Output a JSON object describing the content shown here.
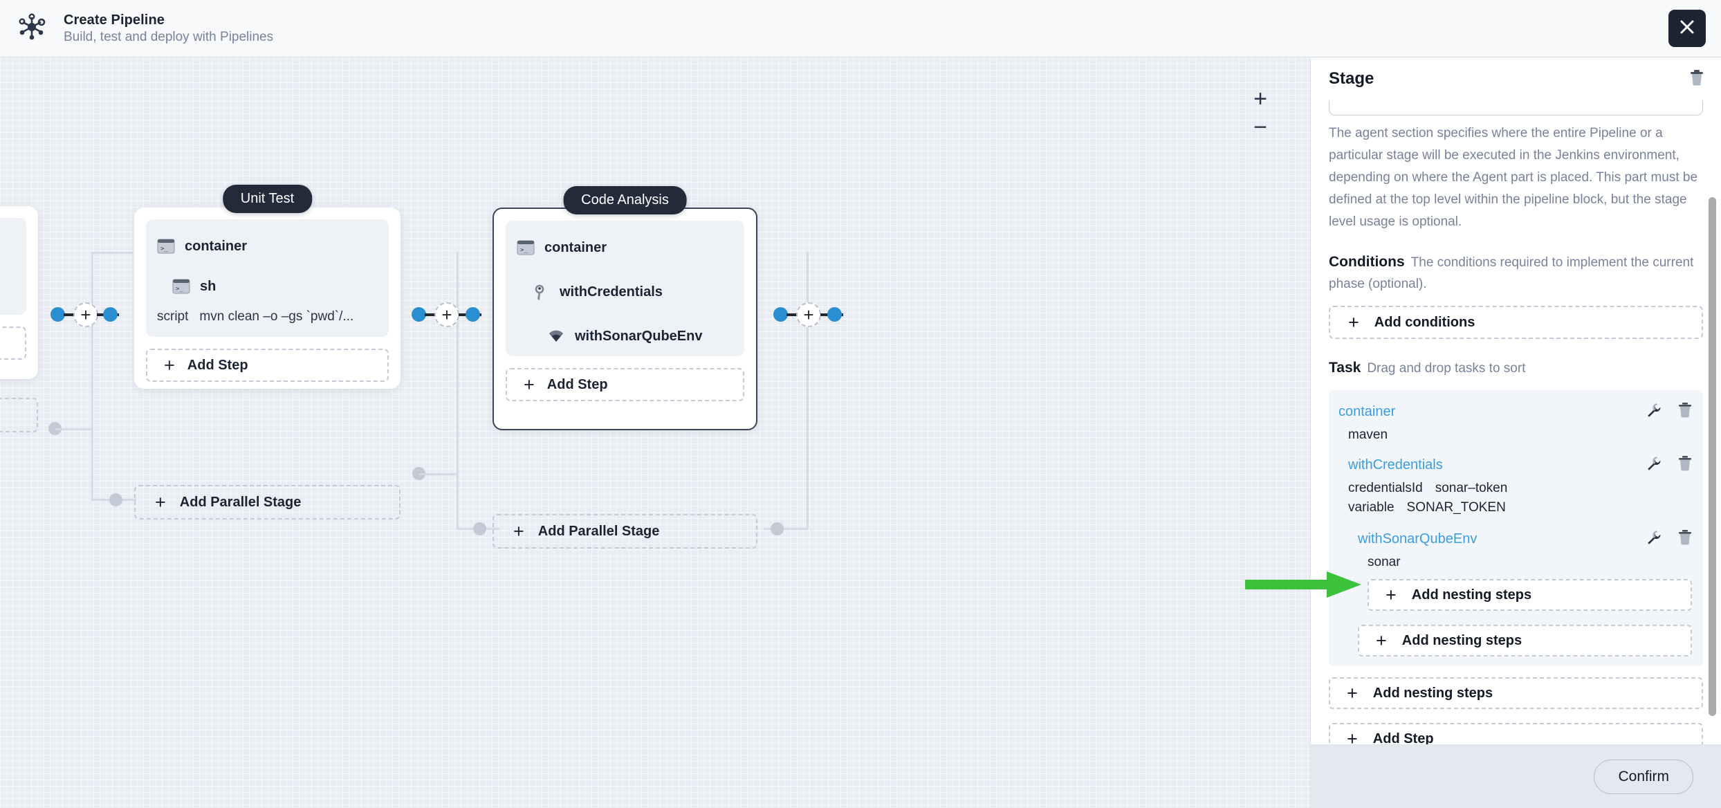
{
  "header": {
    "logo_icon": "pipeline-network-icon",
    "title": "Create Pipeline",
    "subtitle": "Build, test and deploy with Pipelines",
    "close_icon": "close-icon"
  },
  "canvas": {
    "zoom_in_label": "+",
    "zoom_out_label": "−",
    "add_node_label": "+",
    "stages": [
      {
        "name": "Unit Test",
        "steps": [
          {
            "icon": "terminal-icon",
            "label": "container",
            "indent": 0
          },
          {
            "icon": "terminal-icon",
            "label": "sh",
            "indent": 1
          }
        ],
        "params": [
          {
            "key": "script",
            "value": "mvn clean –o –gs `pwd`/..."
          }
        ],
        "add_step_label": "Add Step",
        "add_parallel_label": "Add Parallel Stage"
      },
      {
        "name": "Code Analysis",
        "selected": true,
        "steps": [
          {
            "icon": "terminal-icon",
            "label": "container",
            "indent": 0
          },
          {
            "icon": "key-icon",
            "label": "withCredentials",
            "indent": 1
          },
          {
            "icon": "sonar-icon",
            "label": "withSonarQubeEnv",
            "indent": 2
          }
        ],
        "params": [],
        "add_step_label": "Add Step",
        "add_parallel_label": "Add Parallel Stage"
      }
    ]
  },
  "panel": {
    "title": "Stage",
    "delete_icon": "trash-icon",
    "agent_description": "The agent section specifies where the entire Pipeline or a particular stage will be executed in the Jenkins environment, depending on where the Agent part is placed. This part must be defined at the top level within the pipeline block, but the stage level usage is optional.",
    "conditions": {
      "heading": "Conditions",
      "description": "The conditions required to implement the current phase (optional).",
      "add_label": "Add conditions"
    },
    "task": {
      "heading": "Task",
      "description": "Drag and drop tasks to sort",
      "items": [
        {
          "name": "container",
          "indent": 0,
          "edit_icon": "wrench-icon",
          "delete_icon": "trash-icon",
          "params": [
            {
              "key": "maven",
              "value": ""
            }
          ]
        },
        {
          "name": "withCredentials",
          "indent": 1,
          "edit_icon": "wrench-icon",
          "delete_icon": "trash-icon",
          "params": [
            {
              "key": "credentialsId",
              "value": "sonar–token"
            },
            {
              "key": "variable",
              "value": "SONAR_TOKEN"
            }
          ]
        },
        {
          "name": "withSonarQubeEnv",
          "indent": 2,
          "edit_icon": "wrench-icon",
          "delete_icon": "trash-icon",
          "params": [
            {
              "key": "sonar",
              "value": ""
            }
          ]
        }
      ],
      "nesting_labels": [
        "Add nesting steps",
        "Add nesting steps",
        "Add nesting steps"
      ],
      "add_step_label": "Add Step"
    },
    "confirm_label": "Confirm"
  },
  "annotation": {
    "arrow_icon": "green-arrow-icon",
    "arrow_color": "#3cc13c",
    "points_to": "Add nesting steps"
  },
  "colors": {
    "accent_blue": "#2a8fd0",
    "link_blue": "#3a9ddd",
    "dark": "#232b3b",
    "canvas_bg": "#e9edf3",
    "panel_bg": "#ffffff",
    "task_bg": "#f2f6fa",
    "footer_bg": "#e4e9f0"
  }
}
